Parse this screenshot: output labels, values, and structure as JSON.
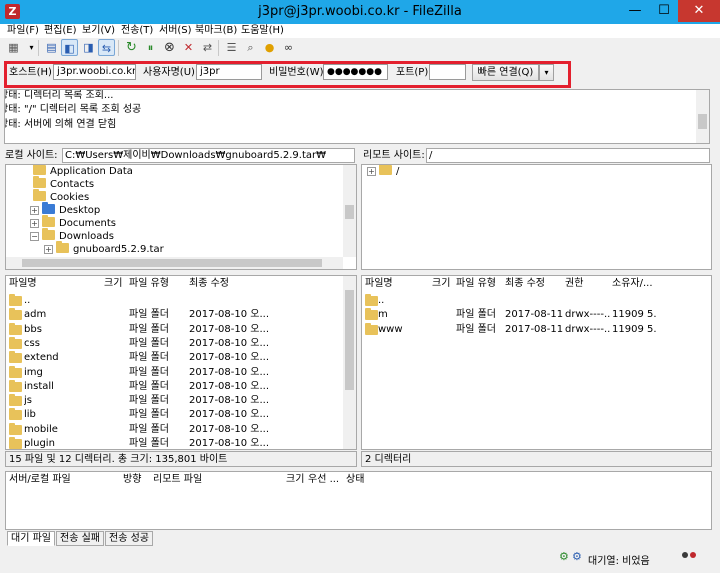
{
  "window": {
    "title": "j3pr@j3pr.woobi.co.kr - FileZilla",
    "app_icon_letter": "Z",
    "minimize": "—",
    "maximize": "☐",
    "close": "✕"
  },
  "menu": [
    "파일(F)",
    "편집(E)",
    "보기(V)",
    "전송(T)",
    "서버(S)",
    "북마크(B)",
    "도움말(H)"
  ],
  "quickconnect": {
    "host_label": "호스트(H):",
    "host_value": "j3pr.woobi.co.kr",
    "user_label": "사용자명(U):",
    "user_value": "j3pr",
    "password_label": "비밀번호(W):",
    "password_value": "●●●●●●●",
    "port_label": "포트(P):",
    "port_value": "",
    "connect_button": "빠른 연결(Q)",
    "dropdown": "▾",
    "highlight_color": "#e3202e"
  },
  "log": [
    {
      "label": "상태:",
      "text": "디렉터리 목록 조회..."
    },
    {
      "label": "상태:",
      "text": "\"/\" 디렉터리 목록 조회 성공"
    },
    {
      "label": "상태:",
      "text": "서버에 의해 연결 닫힘"
    }
  ],
  "local": {
    "site_label": "로컬 사이트:",
    "site_path": "C:₩Users₩제이비₩Downloads₩gnuboard5.2.9.tar₩",
    "tree": [
      {
        "name": "Application Data",
        "expander": ""
      },
      {
        "name": "Contacts",
        "expander": ""
      },
      {
        "name": "Cookies",
        "expander": ""
      },
      {
        "name": "Desktop",
        "expander": "+"
      },
      {
        "name": "Documents",
        "expander": "+"
      },
      {
        "name": "Downloads",
        "expander": "−"
      },
      {
        "name": "gnuboard5.2.9.tar",
        "expander": "+"
      }
    ],
    "columns": [
      "파일명",
      "크기",
      "파일 유형",
      "최종 수정"
    ],
    "files": [
      {
        "name": "..",
        "size": "",
        "type": "",
        "modified": ""
      },
      {
        "name": "adm",
        "size": "",
        "type": "파일 폴더",
        "modified": "2017-08-10 오..."
      },
      {
        "name": "bbs",
        "size": "",
        "type": "파일 폴더",
        "modified": "2017-08-10 오..."
      },
      {
        "name": "css",
        "size": "",
        "type": "파일 폴더",
        "modified": "2017-08-10 오..."
      },
      {
        "name": "extend",
        "size": "",
        "type": "파일 폴더",
        "modified": "2017-08-10 오..."
      },
      {
        "name": "img",
        "size": "",
        "type": "파일 폴더",
        "modified": "2017-08-10 오..."
      },
      {
        "name": "install",
        "size": "",
        "type": "파일 폴더",
        "modified": "2017-08-10 오..."
      },
      {
        "name": "js",
        "size": "",
        "type": "파일 폴더",
        "modified": "2017-08-10 오..."
      },
      {
        "name": "lib",
        "size": "",
        "type": "파일 폴더",
        "modified": "2017-08-10 오..."
      },
      {
        "name": "mobile",
        "size": "",
        "type": "파일 폴더",
        "modified": "2017-08-10 오..."
      },
      {
        "name": "plugin",
        "size": "",
        "type": "파일 폴더",
        "modified": "2017-08-10 오..."
      }
    ],
    "status": "15 파일 및 12 디렉터리. 총 크기: 135,801 바이트"
  },
  "remote": {
    "site_label": "리모트 사이트:",
    "site_path": "/",
    "tree": [
      {
        "name": "/",
        "expander": "+"
      }
    ],
    "columns": [
      "파일명",
      "크기",
      "파일 유형",
      "최종 수정",
      "권한",
      "소유자/..."
    ],
    "files": [
      {
        "name": "..",
        "size": "",
        "type": "",
        "modified": "",
        "perms": "",
        "owner": ""
      },
      {
        "name": "m",
        "size": "",
        "type": "파일 폴더",
        "modified": "2017-08-11...",
        "perms": "drwx----...",
        "owner": "11909 5..."
      },
      {
        "name": "www",
        "size": "",
        "type": "파일 폴더",
        "modified": "2017-08-11...",
        "perms": "drwx----...",
        "owner": "11909 5..."
      }
    ],
    "status": "2 디렉터리"
  },
  "queue": {
    "columns": [
      "서버/로컬 파일",
      "방향",
      "리모트 파일",
      "크기",
      "우선 ...",
      "상태"
    ],
    "tabs": [
      "대기 파일",
      "전송 실패",
      "전송 성공"
    ]
  },
  "statusbar": {
    "queue_text": "대기열: 비었음"
  }
}
